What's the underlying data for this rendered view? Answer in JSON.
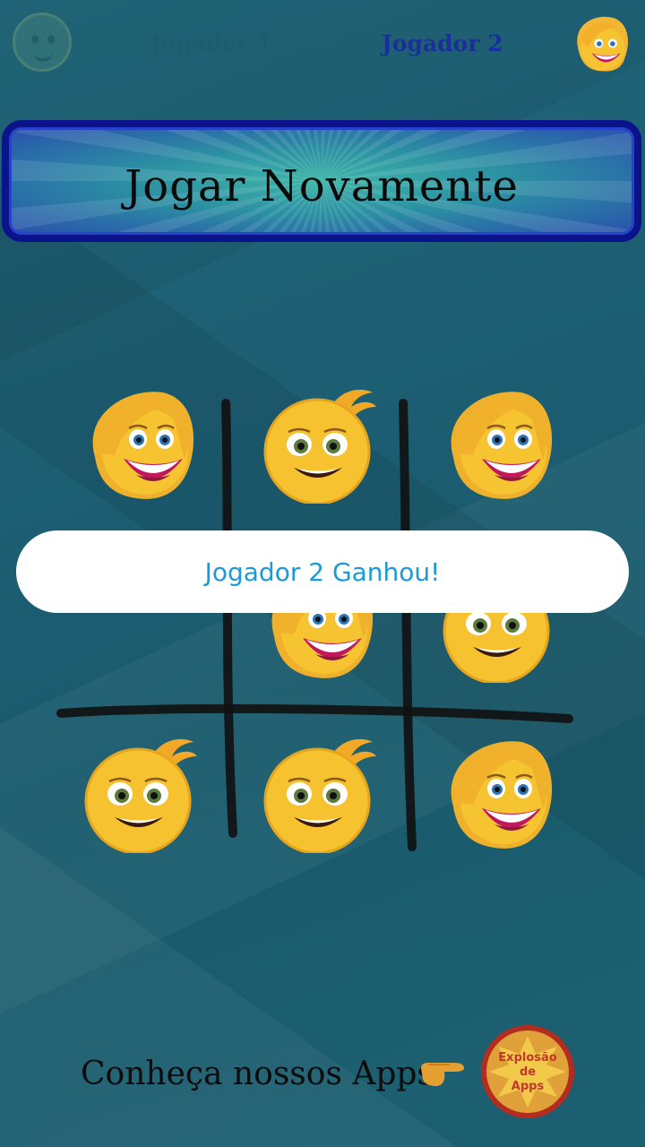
{
  "header": {
    "player1_label": "Jogador 1",
    "player2_label": "Jogador 2",
    "player1_icon": "smiley-emoji-icon",
    "player2_icon": "blonde-emoji-icon"
  },
  "play_again_label": "Jogar Novamente",
  "board": {
    "cells": [
      "blonde",
      "smiley",
      "blonde",
      "",
      "blonde",
      "smiley",
      "smiley",
      "smiley",
      "blonde"
    ]
  },
  "result_message": "Jogador 2 Ganhou!",
  "footer": {
    "promo_text": "Conheça nossos Apps",
    "hand_icon": "pointing-hand-icon",
    "logo_text": [
      "Explosão",
      "de",
      "Apps"
    ]
  },
  "colors": {
    "background": "#246e86",
    "button_border": "#0b138a",
    "player2_label": "#1a2f9a",
    "toast_text": "#1a9ad8"
  }
}
